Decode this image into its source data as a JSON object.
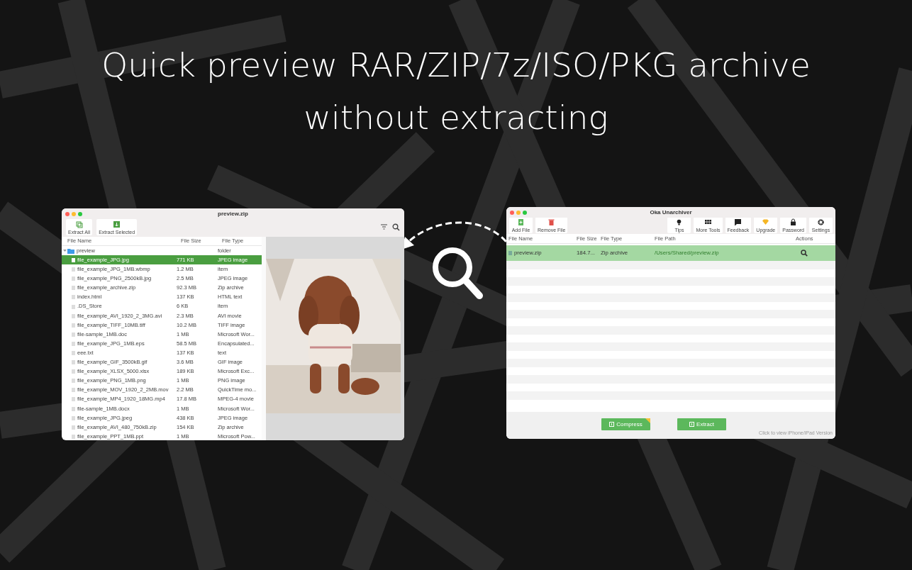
{
  "headline": "Quick preview RAR/ZIP/7z/ISO/PKG archive without extracting",
  "preview_window": {
    "title": "preview.zip",
    "toolbar": [
      {
        "kind": "extract-all",
        "label": "Extract All"
      },
      {
        "kind": "extract-selected",
        "label": "Extract Selected"
      }
    ],
    "columns": [
      "File Name",
      "File Size",
      "File Type"
    ],
    "tree": [
      {
        "name": "preview",
        "type": "folder",
        "expanded": true,
        "selected": false,
        "children": [
          {
            "name": "file_example_JPG.jpg",
            "size": "771 KB",
            "type": "JPEG image",
            "selected": true
          },
          {
            "name": "file_example_JPG_1MB.wbmp",
            "size": "1.2 MB",
            "type": "item",
            "selected": false
          },
          {
            "name": "file_example_PNG_2500kB.jpg",
            "size": "2.5 MB",
            "type": "JPEG image",
            "selected": false
          },
          {
            "name": "file_example_archive.zip",
            "size": "92.3 MB",
            "type": "Zip archive",
            "selected": false
          },
          {
            "name": "index.html",
            "size": "137 KB",
            "type": "HTML text",
            "selected": false
          },
          {
            "name": ".DS_Store",
            "size": "6 KB",
            "type": "item",
            "selected": false
          },
          {
            "name": "file_example_AVI_1920_2_3MG.avi",
            "size": "2.3 MB",
            "type": "AVI movie",
            "selected": false
          },
          {
            "name": "file_example_TIFF_10MB.tiff",
            "size": "10.2 MB",
            "type": "TIFF image",
            "selected": false
          },
          {
            "name": "file-sample_1MB.doc",
            "size": "1 MB",
            "type": "Microsoft Wor...",
            "selected": false
          },
          {
            "name": "file_example_JPG_1MB.eps",
            "size": "58.5 MB",
            "type": "Encapsulated...",
            "selected": false
          },
          {
            "name": "eee.txt",
            "size": "137 KB",
            "type": "text",
            "selected": false
          },
          {
            "name": "file_example_GIF_3500kB.gif",
            "size": "3.6 MB",
            "type": "GIF image",
            "selected": false
          },
          {
            "name": "file_example_XLSX_5000.xlsx",
            "size": "189 KB",
            "type": "Microsoft Exc...",
            "selected": false
          },
          {
            "name": "file_example_PNG_1MB.png",
            "size": "1 MB",
            "type": "PNG image",
            "selected": false
          },
          {
            "name": "file_example_MOV_1920_2_2MB.mov",
            "size": "2.2 MB",
            "type": "QuickTime mo...",
            "selected": false
          },
          {
            "name": "file_example_MP4_1920_18MG.mp4",
            "size": "17.8 MB",
            "type": "MPEG-4 movie",
            "selected": false
          },
          {
            "name": "file-sample_1MB.docx",
            "size": "1 MB",
            "type": "Microsoft Wor...",
            "selected": false
          },
          {
            "name": "file_example_JPG.jpeg",
            "size": "438 KB",
            "type": "JPEG image",
            "selected": false
          },
          {
            "name": "file_example_AVI_480_750kB.zip",
            "size": "154 KB",
            "type": "Zip archive",
            "selected": false
          },
          {
            "name": "file_example_PPT_1MB.ppt",
            "size": "1 MB",
            "type": "Microsoft Pow...",
            "selected": false
          }
        ]
      }
    ]
  },
  "main_window": {
    "title": "Oka Unarchiver",
    "toolbar_left": [
      {
        "kind": "add",
        "label": "Add File"
      },
      {
        "kind": "remove",
        "label": "Remove File"
      }
    ],
    "toolbar_right": [
      {
        "kind": "tips",
        "label": "Tips"
      },
      {
        "kind": "tools",
        "label": "More Tools"
      },
      {
        "kind": "feedback",
        "label": "Feedback"
      },
      {
        "kind": "upgrade",
        "label": "Upgrade"
      },
      {
        "kind": "password",
        "label": "Password"
      },
      {
        "kind": "settings",
        "label": "Settings"
      }
    ],
    "columns": [
      "File Name",
      "File Size",
      "File Type",
      "File Path",
      "Actions"
    ],
    "rows": [
      {
        "name": "preview.zip",
        "size": "184.7...",
        "type": "Zip archive",
        "path": "/Users/Shared/preview.zip",
        "selected": true
      }
    ],
    "buttons": [
      {
        "label": "Compress",
        "tag": true
      },
      {
        "label": "Extract",
        "tag": false
      }
    ],
    "footer_link": "Click to view iPhone/iPad Version"
  }
}
